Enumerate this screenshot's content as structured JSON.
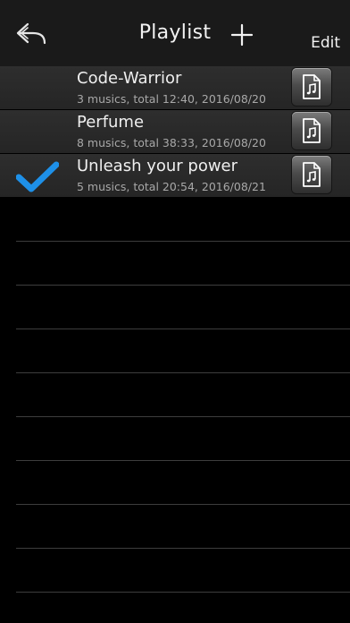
{
  "header": {
    "back_icon": "back-arrow-icon",
    "title": "Playlist",
    "add_icon": "plus-icon",
    "edit_label": "Edit"
  },
  "playlists": [
    {
      "name": "Code-Warrior",
      "meta": "3 musics, total 12:40, 2016/08/20",
      "selected": false,
      "action_icon": "music-file-icon"
    },
    {
      "name": "Perfume",
      "meta": "8 musics, total 38:33, 2016/08/20",
      "selected": false,
      "action_icon": "music-file-icon"
    },
    {
      "name": "Unleash your power",
      "meta": "5 musics, total 20:54, 2016/08/21",
      "selected": true,
      "action_icon": "music-file-icon"
    }
  ],
  "colors": {
    "checkmark": "#1e90e8",
    "background": "#000000",
    "row": "#2a2a2a"
  }
}
